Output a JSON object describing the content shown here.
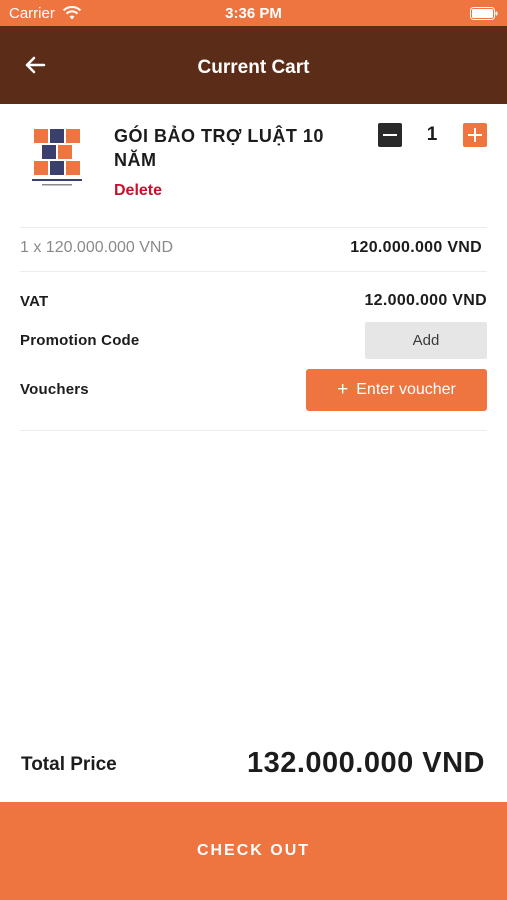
{
  "status_bar": {
    "carrier": "Carrier",
    "time": "3:36 PM"
  },
  "header": {
    "title": "Current Cart",
    "back_icon": "arrow-left-icon"
  },
  "cart_item": {
    "name": "GÓI BẢO TRỢ LUẬT 10 NĂM",
    "delete_label": "Delete",
    "quantity": "1",
    "unit_line": "1 x 120.000.000 VND",
    "line_total": "120.000.000 VND"
  },
  "summary": {
    "vat_label": "VAT",
    "vat_value": "12.000.000 VND",
    "promo_label": "Promotion Code",
    "promo_button": "Add",
    "voucher_label": "Vouchers",
    "voucher_button": "Enter voucher",
    "voucher_plus": "+"
  },
  "footer": {
    "total_label": "Total Price",
    "total_value": "132.000.000 VND",
    "checkout_label": "CHECK OUT"
  },
  "colors": {
    "accent": "#ee7440",
    "header_bg": "#5b2c17",
    "delete": "#c8102e"
  }
}
